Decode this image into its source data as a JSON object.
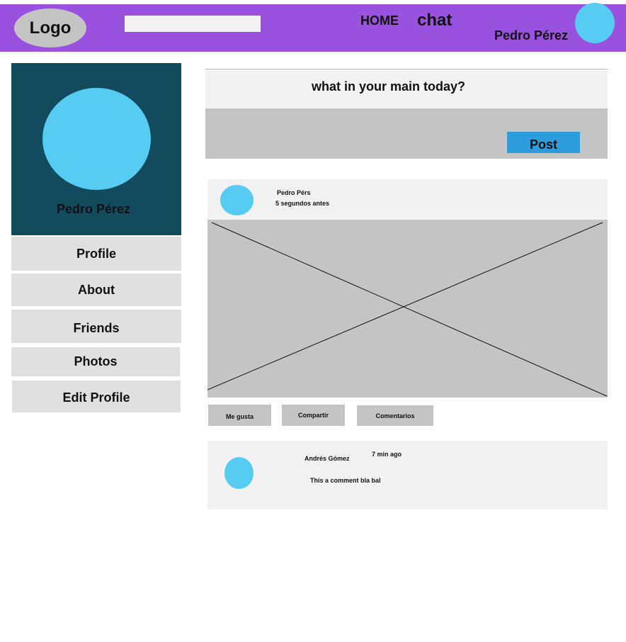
{
  "header": {
    "logo": "Logo",
    "search": {
      "value": "",
      "placeholder": ""
    },
    "nav": {
      "home": "HOME",
      "chat": "chat"
    },
    "user_name": "Pedro Pérez",
    "colors": {
      "bar": "#9b51e0",
      "avatar": "#56ccf2"
    }
  },
  "sidebar": {
    "profile_name": "Pedro Pérez",
    "menu": [
      "Profile",
      "About",
      "Friends",
      "Photos",
      "Edit Profile"
    ],
    "colors": {
      "card": "#124b5e",
      "menu_bg": "#e0e0e0"
    }
  },
  "composer": {
    "prompt": "what  in  your main  today?",
    "post_label": "Post",
    "colors": {
      "button": "#2d9cdb"
    }
  },
  "post": {
    "author": "Pedro Pérs",
    "time": "5 segundos antes",
    "image_icon": "image-placeholder-icon",
    "actions": [
      "Me gusta",
      "Compartir",
      "Comentarios"
    ]
  },
  "comment": {
    "author": "Andrés Gómez",
    "time": "7 min ago",
    "text": "This a comment  bla bal"
  }
}
